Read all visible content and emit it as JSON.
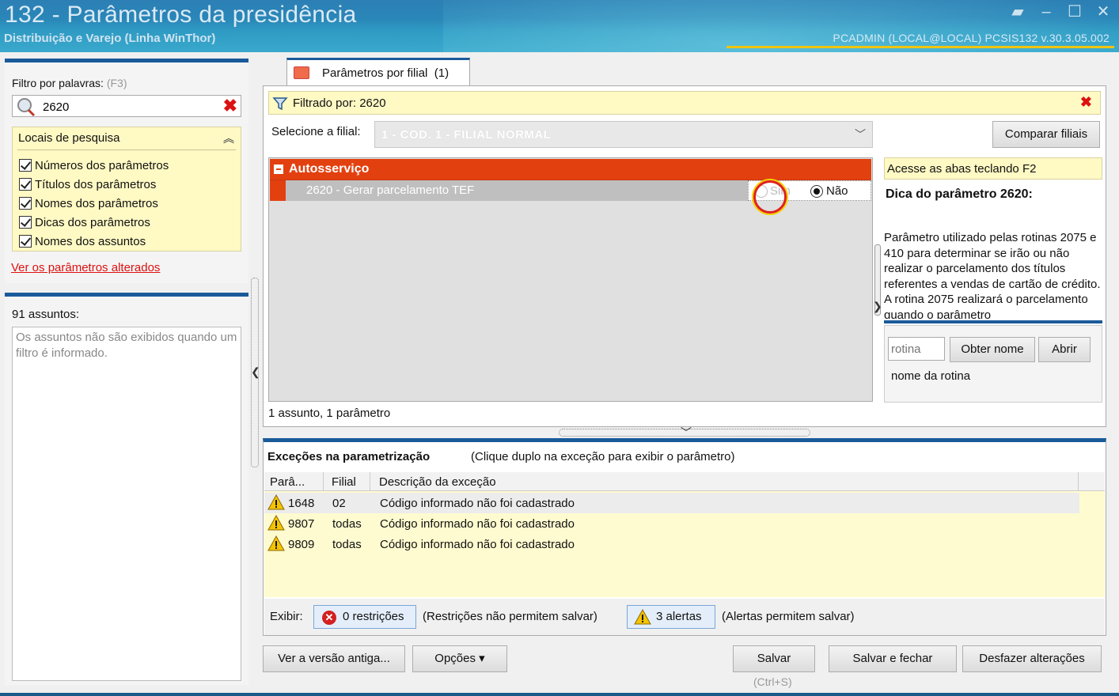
{
  "window": {
    "title": "132 - Parâmetros da presidência",
    "subtitle": "Distribuição e Varejo (Linha WinThor)",
    "status": "PCADMIN (LOCAL@LOCAL)   PCSIS132  v.30.3.05.002"
  },
  "filter": {
    "label": "Filtro por palavras:",
    "shortcut": "(F3)",
    "value": "2620",
    "clear_icon": "✖",
    "locais": {
      "header": "Locais de pesquisa",
      "items": [
        {
          "label": "Números dos parâmetros",
          "checked": true
        },
        {
          "label": "Títulos dos parâmetros",
          "checked": true
        },
        {
          "label": "Nomes dos parâmetros",
          "checked": true
        },
        {
          "label": "Dicas dos parâmetros",
          "checked": true
        },
        {
          "label": "Nomes dos assuntos",
          "checked": true
        }
      ]
    },
    "altered_link": "Ver os parâmetros alterados"
  },
  "assuntos": {
    "count_label": "91 assuntos:",
    "empty_message": "Os assuntos não são exibidos quando um filtro é informado."
  },
  "tab": {
    "label": "Parâmetros por filial",
    "count": "(1)"
  },
  "filtered": {
    "text": "Filtrado por: 2620",
    "close_icon": "✖"
  },
  "filial": {
    "label": "Selecione a filial:",
    "value": "1 - COD. 1 - FILIAL NORMAL",
    "compare_button": "Comparar filiais"
  },
  "group": {
    "title": "Autosserviço",
    "param_label": "2620 - Gerar parcelamento TEF",
    "option_sim": "Sim",
    "option_nao": "Não",
    "selected": "Não"
  },
  "summary": "1 assunto, 1 parâmetro",
  "tip": {
    "bar": "Acesse as abas teclando F2",
    "title": "Dica do parâmetro 2620:",
    "body": "Parâmetro utilizado pelas rotinas 2075 e 410 para determinar se irão ou não realizar o parcelamento dos títulos referentes a vendas de cartão de crédito. A rotina 2075 realizará o parcelamento quando o parâmetro"
  },
  "rotina": {
    "placeholder": "rotina",
    "obter_button": "Obter nome",
    "abrir_button": "Abrir",
    "name_label": "nome da rotina"
  },
  "excecoes": {
    "title": "Exceções na parametrização",
    "hint": "(Clique duplo na exceção para exibir o parâmetro)",
    "columns": [
      "Parâ...",
      "Filial",
      "Descrição da exceção"
    ],
    "rows": [
      {
        "param": "1648",
        "filial": "02",
        "descricao": "Código informado não foi cadastrado"
      },
      {
        "param": "9807",
        "filial": "todas",
        "descricao": "Código informado não foi cadastrado"
      },
      {
        "param": "9809",
        "filial": "todas",
        "descricao": "Código informado não foi cadastrado"
      }
    ],
    "exibir_label": "Exibir:",
    "restricoes_button": "0 restrições",
    "restricoes_note": "(Restrições não permitem salvar)",
    "alertas_button": "3 alertas",
    "alertas_note": "(Alertas permitem salvar)"
  },
  "footer": {
    "versao_antiga": "Ver a versão antiga...",
    "opcoes": "Opções ▾",
    "salvar": "Salvar",
    "salvar_shortcut": "(Ctrl+S)",
    "salvar_fechar": "Salvar e fechar",
    "desfazer": "Desfazer alterações"
  },
  "colors": {
    "accent_blue": "#1a5a9a",
    "group_orange": "#e3400f",
    "highlight_yellow": "#fff9c4",
    "error_red": "#d11111"
  }
}
